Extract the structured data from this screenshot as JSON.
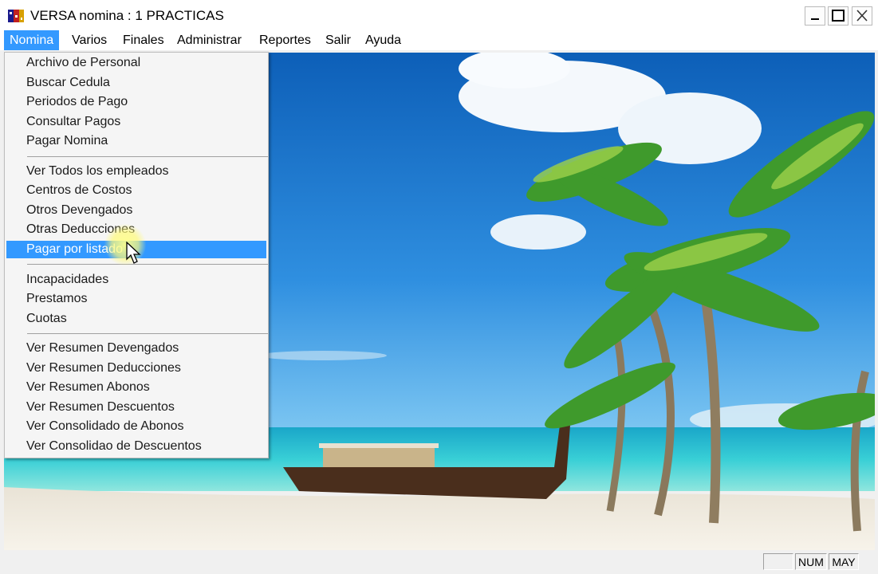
{
  "window": {
    "title": "VERSA nomina : 1 PRACTICAS",
    "buttons": {
      "minimize": "minimize",
      "maximize": "maximize",
      "close": "close"
    }
  },
  "menubar": {
    "items": [
      "Nomina",
      "Varios",
      "Finales",
      "Administrar",
      "Reportes",
      "Salir",
      "Ayuda"
    ],
    "active": "Nomina"
  },
  "dropdown": {
    "groups": [
      [
        "Archivo de Personal",
        "Buscar Cedula",
        "Periodos de Pago",
        "Consultar Pagos",
        "Pagar Nomina"
      ],
      [
        "Ver Todos los empleados",
        "Centros de Costos",
        "Otros Devengados",
        "Otras Deducciones",
        "Pagar por listado"
      ],
      [
        "Incapacidades",
        "Prestamos",
        "Cuotas"
      ],
      [
        "Ver Resumen Devengados",
        "Ver Resumen Deducciones",
        "Ver Resumen Abonos",
        "Ver Resumen Descuentos",
        "Ver Consolidado de Abonos",
        "Ver Consolidao de Descuentos"
      ]
    ],
    "highlighted": "Pagar por listado"
  },
  "statusbar": {
    "num": "NUM",
    "caps": "MAY"
  },
  "colors": {
    "menu_highlight": "#3399ff",
    "sky": "#1f7fd6",
    "sea": "#2ec5d0"
  }
}
